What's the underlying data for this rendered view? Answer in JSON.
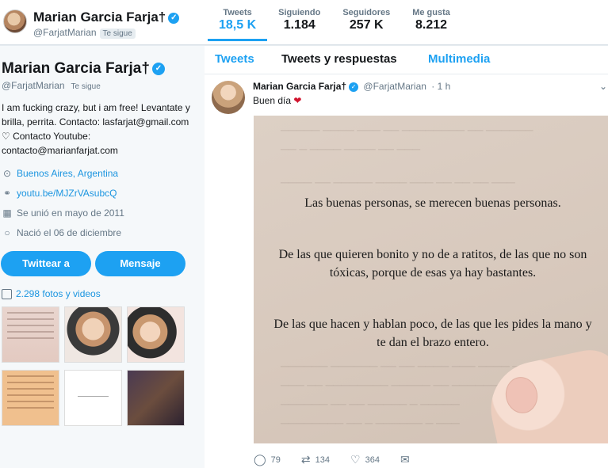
{
  "header": {
    "name": "Marian Garcia Farja†",
    "handle": "@FarjatMarian",
    "follows_you": "Te sigue"
  },
  "stats": [
    {
      "label": "Tweets",
      "value": "18,5 K"
    },
    {
      "label": "Siguiendo",
      "value": "1.184"
    },
    {
      "label": "Seguidores",
      "value": "257 K"
    },
    {
      "label": "Me gusta",
      "value": "8.212"
    }
  ],
  "profile": {
    "name": "Marian Garcia Farja†",
    "handle": "@FarjatMarian",
    "follows_you": "Te sigue",
    "bio": "I am fucking crazy, but i am free! Levantate y brilla, perrita. Contacto: lasfarjat@gmail.com ♡ Contacto Youtube: contacto@marianfarjat.com",
    "location": "Buenos Aires, Argentina",
    "website": "youtu.be/MJZrVAsubcQ",
    "joined": "Se unió en mayo de 2011",
    "birthday": "Nació el 06 de diciembre",
    "tweet_button": "Twittear a",
    "message_button": "Mensaje",
    "photos_link": "2.298 fotos y videos"
  },
  "tabs": {
    "tweets": "Tweets",
    "replies": "Tweets y respuestas",
    "media": "Multimedia"
  },
  "tweet": {
    "name": "Marian Garcia Farja†",
    "handle": "@FarjatMarian",
    "time": "· 1 h",
    "text": "Buen día",
    "image_text": [
      "Las buenas personas, se merecen buenas personas.",
      "De las que quieren bonito y no de a ratitos, de las que no son tóxicas, porque de esas ya hay bastantes.",
      "De las que hacen y hablan poco, de las que les pides la mano y te dan el brazo entero."
    ],
    "replies": "79",
    "retweets": "134",
    "likes": "364"
  },
  "colors": {
    "accent": "#1da1f2",
    "verified": "#1da1f2",
    "heart": "#d1142e"
  }
}
